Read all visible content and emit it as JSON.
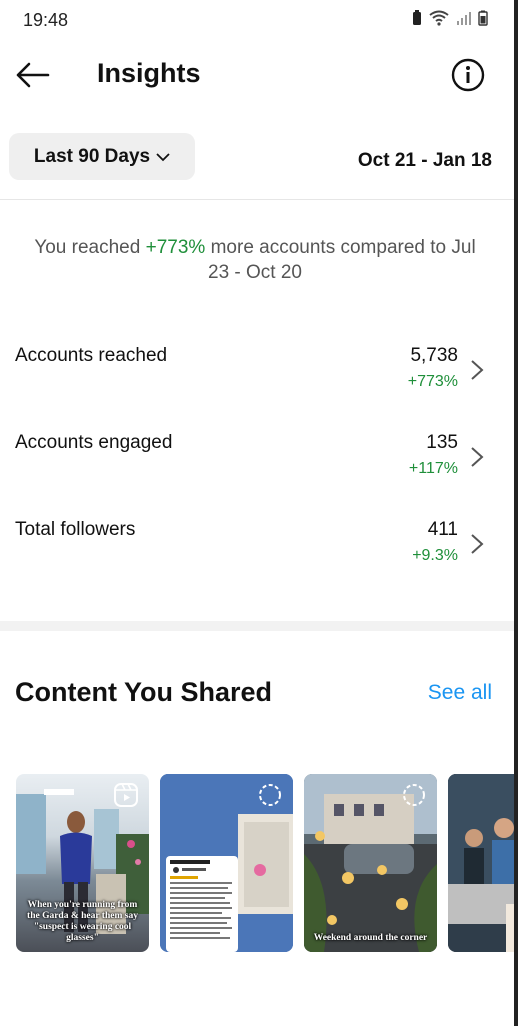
{
  "status_bar": {
    "time": "19:48"
  },
  "header": {
    "title": "Insights"
  },
  "filter": {
    "range_label": "Last 90 Days",
    "date_range": "Oct 21 - Jan 18"
  },
  "summary": {
    "prefix": "You reached ",
    "percent": "+773%",
    "suffix": " more accounts compared to Jul 23 - Oct 20"
  },
  "metrics": [
    {
      "label": "Accounts reached",
      "value": "5,738",
      "delta": "+773%"
    },
    {
      "label": "Accounts engaged",
      "value": "135",
      "delta": "+117%"
    },
    {
      "label": "Total followers",
      "value": "411",
      "delta": "+9.3%"
    }
  ],
  "content": {
    "title": "Content You Shared",
    "see_all": "See all",
    "thumbnails": [
      {
        "caption": "When you're running from the Garda & hear them say \"suspect is wearing cool glasses\"",
        "badge": "reel-icon"
      },
      {
        "caption": "",
        "badge": "carousel-icon"
      },
      {
        "caption": "Weekend around the corner",
        "badge": "carousel-icon"
      },
      {
        "caption": "",
        "badge": ""
      }
    ]
  },
  "colors": {
    "accent_green": "#1f8f3a",
    "link_blue": "#1a95f2"
  }
}
